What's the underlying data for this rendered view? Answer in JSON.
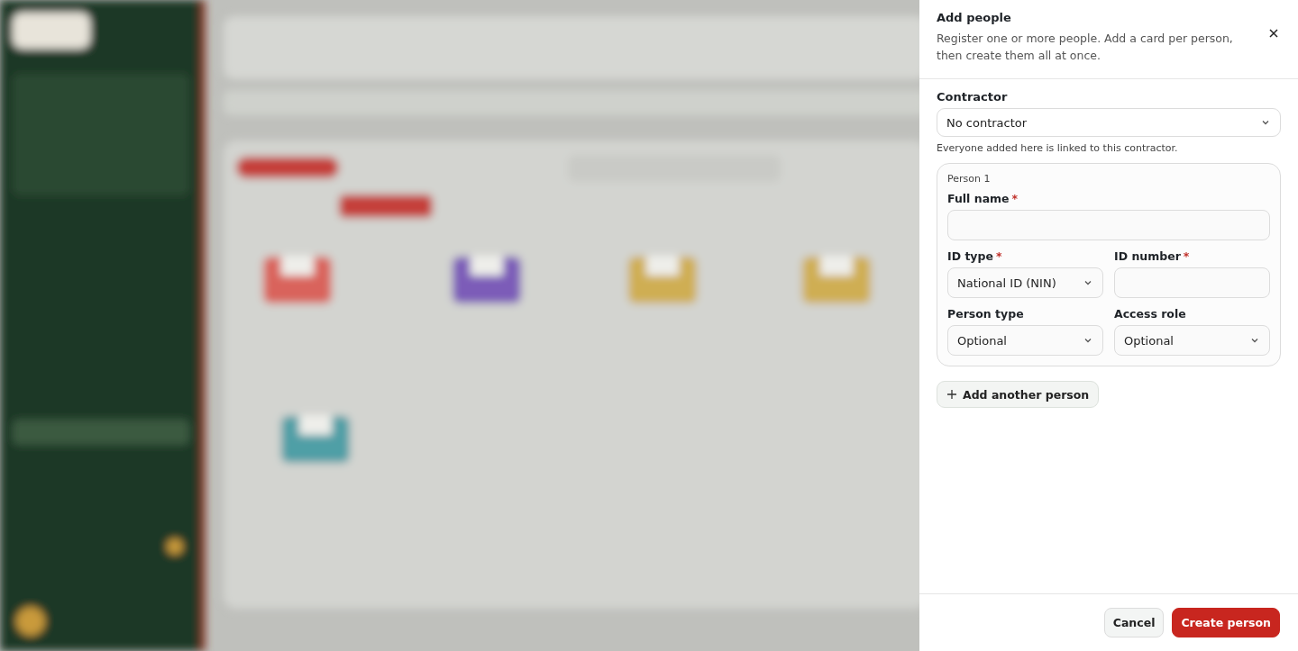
{
  "drawer": {
    "title": "Add people",
    "description": "Register one or more people. Add a card per person, then create them all at once.",
    "contractor": {
      "label": "Contractor",
      "value": "No contractor",
      "hint": "Everyone added here is linked to this contractor."
    },
    "people": [
      {
        "heading": "Person 1",
        "rows": [
          [
            {
              "label": "Full name",
              "required_mark": "*",
              "kind": "text"
            }
          ],
          [
            {
              "label": "ID type",
              "required_mark": "*",
              "kind": "select",
              "value": "National ID (NIN)"
            },
            {
              "label": "ID number",
              "required_mark": "*",
              "kind": "text"
            }
          ],
          [
            {
              "label": "Person type",
              "kind": "select",
              "value": "Optional"
            },
            {
              "label": "Access role",
              "kind": "select",
              "value": "Optional"
            }
          ]
        ]
      }
    ],
    "add_button": "Add another person",
    "buttons": [
      {
        "label": "Cancel",
        "kind": "secondary"
      },
      {
        "label": "Create person",
        "kind": "primary"
      }
    ]
  }
}
